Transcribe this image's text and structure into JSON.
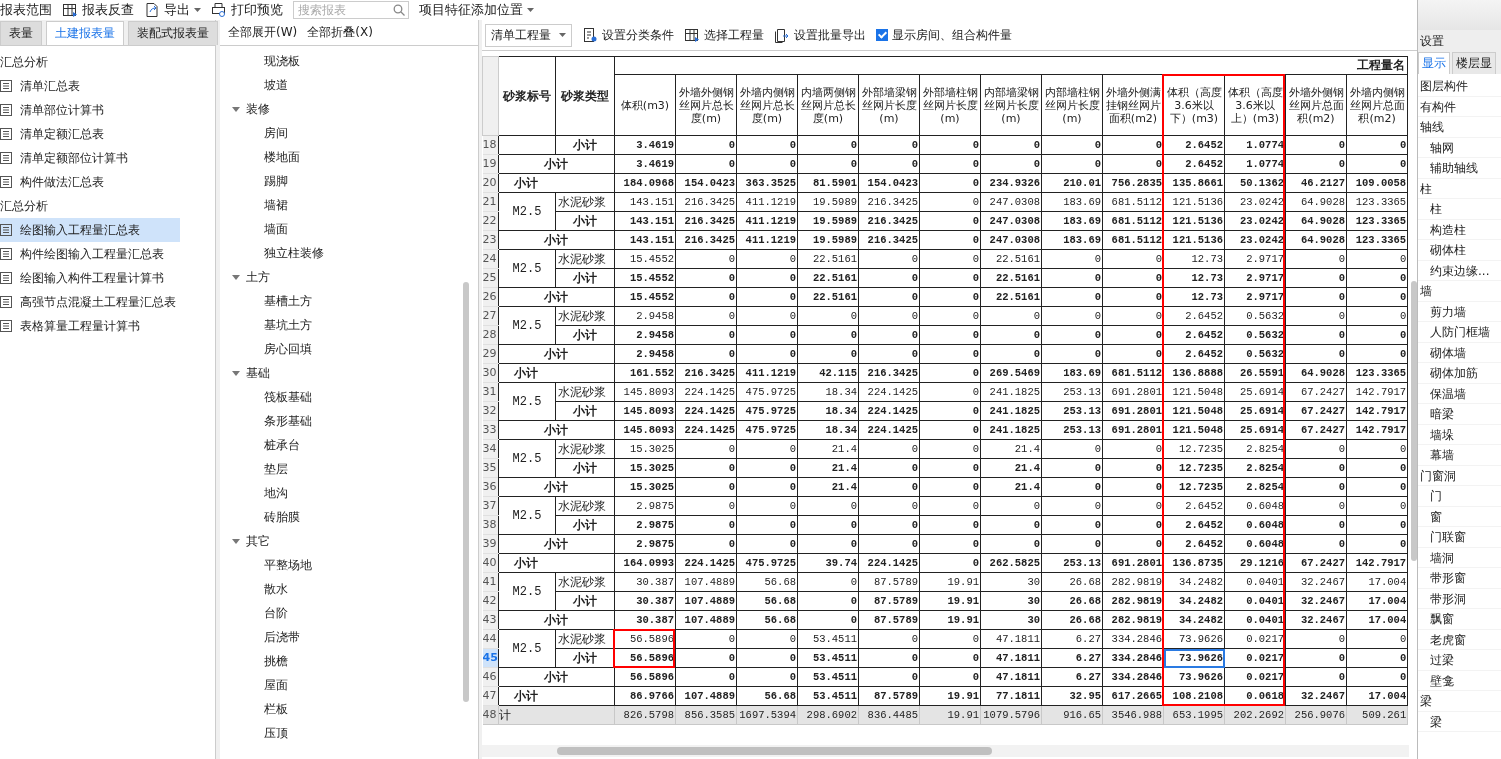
{
  "toolbar": {
    "items": [
      {
        "kind": "button",
        "label": "报表范围"
      },
      {
        "kind": "button",
        "label": "报表反查"
      },
      {
        "kind": "menu",
        "label": "导出"
      },
      {
        "kind": "button",
        "label": "打印预览"
      },
      {
        "kind": "search",
        "placeholder": "搜索报表"
      },
      {
        "kind": "menu",
        "label": "项目特征添加位置"
      }
    ]
  },
  "report_tabs": [
    {
      "label": "表量",
      "selected": false
    },
    {
      "label": "土建报表量",
      "selected": true
    },
    {
      "label": "装配式报表量",
      "selected": false
    }
  ],
  "report_tree": [
    {
      "label": "汇总分析",
      "children": [
        {
          "label": "清单汇总表",
          "selected": false
        },
        {
          "label": "清单部位计算书",
          "selected": false
        },
        {
          "label": "清单定额汇总表",
          "selected": false
        },
        {
          "label": "清单定额部位计算书",
          "selected": false
        },
        {
          "label": "构件做法汇总表",
          "selected": false
        }
      ]
    },
    {
      "label": "汇总分析",
      "children": [
        {
          "label": "绘图输入工程量汇总表",
          "selected": true
        },
        {
          "label": "构件绘图输入工程量汇总表",
          "selected": false
        },
        {
          "label": "绘图输入构件工程量计算书",
          "selected": false
        },
        {
          "label": "高强节点混凝土工程量汇总表",
          "selected": false
        },
        {
          "label": "表格算量工程量计算书",
          "selected": false
        }
      ]
    }
  ],
  "component_panel": {
    "buttons": [
      "全部展开(W)",
      "全部折叠(X)"
    ],
    "continued_items": [
      "现浇板",
      "坡道"
    ],
    "groups": [
      {
        "label": "装修",
        "expanded": true,
        "children": [
          "房间",
          "楼地面",
          "踢脚",
          "墙裙",
          "墙面",
          "独立柱装修"
        ]
      },
      {
        "label": "土方",
        "expanded": true,
        "children": [
          "基槽土方",
          "基坑土方",
          "房心回填"
        ]
      },
      {
        "label": "基础",
        "expanded": true,
        "children": [
          "筏板基础",
          "条形基础",
          "桩承台",
          "垫层",
          "地沟",
          "砖胎膜"
        ]
      },
      {
        "label": "其它",
        "expanded": true,
        "children": [
          "平整场地",
          "散水",
          "台阶",
          "后浇带",
          "挑檐",
          "屋面",
          "栏板",
          "压顶"
        ]
      }
    ]
  },
  "table_toolbar": {
    "dropdown": "清单工程量",
    "buttons": [
      "设置分类条件",
      "选择工程量",
      "设置批量导出"
    ],
    "checkbox": {
      "label": "显示房间、组合构件量",
      "checked": true
    }
  },
  "table": {
    "group_header": "工程量名",
    "columns": [
      "砂浆标号",
      "砂浆类型",
      "体积(m3)",
      "外墙外侧钢丝网片总长度(m)",
      "外墙内侧钢丝网片总长度(m)",
      "内墙两侧钢丝网片总长度(m)",
      "外部墙梁钢丝网片长度(m)",
      "外部墙柱钢丝网片长度(m)",
      "内部墙梁钢丝网片长度(m)",
      "内部墙柱钢丝网片长度(m)",
      "外墙外侧满挂钢丝网片面积(m2)",
      "体积（高度3.6米以下）(m3)",
      "体积（高度3.6米以上）(m3)",
      "外墙外侧钢丝网片总面积(m2)",
      "外墙内侧钢丝网片总面积(m2)"
    ],
    "rows": [
      {
        "num": "18",
        "kind": "sub",
        "label": "小计",
        "selected": false,
        "values": [
          "3.4619",
          "0",
          "0",
          "0",
          "0",
          "0",
          "0",
          "0",
          "0",
          "2.6452",
          "1.0774",
          "0",
          "0"
        ]
      },
      {
        "num": "19",
        "kind": "group",
        "label": "小计",
        "selected": false,
        "values": [
          "3.4619",
          "0",
          "0",
          "0",
          "0",
          "0",
          "0",
          "0",
          "0",
          "2.6452",
          "1.0774",
          "0",
          "0"
        ]
      },
      {
        "num": "20",
        "kind": "total",
        "label": "小计",
        "selected": false,
        "values": [
          "184.0968",
          "154.0423",
          "363.3525",
          "81.5901",
          "154.0423",
          "0",
          "234.9326",
          "210.01",
          "756.2835",
          "135.8661",
          "50.1362",
          "46.2127",
          "109.0058"
        ]
      },
      {
        "num": "21",
        "kind": "detail",
        "grade": "M2.5",
        "label": "水泥砂浆",
        "selected": false,
        "values": [
          "143.151",
          "216.3425",
          "411.1219",
          "19.5989",
          "216.3425",
          "0",
          "247.0308",
          "183.69",
          "681.5112",
          "121.5136",
          "23.0242",
          "64.9028",
          "123.3365"
        ]
      },
      {
        "num": "22",
        "kind": "sub",
        "label": "小计",
        "selected": false,
        "values": [
          "143.151",
          "216.3425",
          "411.1219",
          "19.5989",
          "216.3425",
          "0",
          "247.0308",
          "183.69",
          "681.5112",
          "121.5136",
          "23.0242",
          "64.9028",
          "123.3365"
        ]
      },
      {
        "num": "23",
        "kind": "group",
        "label": "小计",
        "selected": false,
        "values": [
          "143.151",
          "216.3425",
          "411.1219",
          "19.5989",
          "216.3425",
          "0",
          "247.0308",
          "183.69",
          "681.5112",
          "121.5136",
          "23.0242",
          "64.9028",
          "123.3365"
        ]
      },
      {
        "num": "24",
        "kind": "detail",
        "grade": "M2.5",
        "label": "水泥砂浆",
        "selected": false,
        "values": [
          "15.4552",
          "0",
          "0",
          "22.5161",
          "0",
          "0",
          "22.5161",
          "0",
          "0",
          "12.73",
          "2.9717",
          "0",
          "0"
        ]
      },
      {
        "num": "25",
        "kind": "sub",
        "label": "小计",
        "selected": false,
        "values": [
          "15.4552",
          "0",
          "0",
          "22.5161",
          "0",
          "0",
          "22.5161",
          "0",
          "0",
          "12.73",
          "2.9717",
          "0",
          "0"
        ]
      },
      {
        "num": "26",
        "kind": "group",
        "label": "小计",
        "selected": false,
        "values": [
          "15.4552",
          "0",
          "0",
          "22.5161",
          "0",
          "0",
          "22.5161",
          "0",
          "0",
          "12.73",
          "2.9717",
          "0",
          "0"
        ]
      },
      {
        "num": "27",
        "kind": "detail",
        "grade": "M2.5",
        "label": "水泥砂浆",
        "selected": false,
        "values": [
          "2.9458",
          "0",
          "0",
          "0",
          "0",
          "0",
          "0",
          "0",
          "0",
          "2.6452",
          "0.5632",
          "0",
          "0"
        ]
      },
      {
        "num": "28",
        "kind": "sub",
        "label": "小计",
        "selected": false,
        "values": [
          "2.9458",
          "0",
          "0",
          "0",
          "0",
          "0",
          "0",
          "0",
          "0",
          "2.6452",
          "0.5632",
          "0",
          "0"
        ]
      },
      {
        "num": "29",
        "kind": "group",
        "label": "小计",
        "selected": false,
        "values": [
          "2.9458",
          "0",
          "0",
          "0",
          "0",
          "0",
          "0",
          "0",
          "0",
          "2.6452",
          "0.5632",
          "0",
          "0"
        ]
      },
      {
        "num": "30",
        "kind": "total",
        "label": "小计",
        "selected": false,
        "values": [
          "161.552",
          "216.3425",
          "411.1219",
          "42.115",
          "216.3425",
          "0",
          "269.5469",
          "183.69",
          "681.5112",
          "136.8888",
          "26.5591",
          "64.9028",
          "123.3365"
        ]
      },
      {
        "num": "31",
        "kind": "detail",
        "grade": "M2.5",
        "label": "水泥砂浆",
        "selected": false,
        "values": [
          "145.8093",
          "224.1425",
          "475.9725",
          "18.34",
          "224.1425",
          "0",
          "241.1825",
          "253.13",
          "691.2801",
          "121.5048",
          "25.6914",
          "67.2427",
          "142.7917"
        ]
      },
      {
        "num": "32",
        "kind": "sub",
        "label": "小计",
        "selected": false,
        "values": [
          "145.8093",
          "224.1425",
          "475.9725",
          "18.34",
          "224.1425",
          "0",
          "241.1825",
          "253.13",
          "691.2801",
          "121.5048",
          "25.6914",
          "67.2427",
          "142.7917"
        ]
      },
      {
        "num": "33",
        "kind": "group",
        "label": "小计",
        "selected": false,
        "values": [
          "145.8093",
          "224.1425",
          "475.9725",
          "18.34",
          "224.1425",
          "0",
          "241.1825",
          "253.13",
          "691.2801",
          "121.5048",
          "25.6914",
          "67.2427",
          "142.7917"
        ]
      },
      {
        "num": "34",
        "kind": "detail",
        "grade": "M2.5",
        "label": "水泥砂浆",
        "selected": false,
        "values": [
          "15.3025",
          "0",
          "0",
          "21.4",
          "0",
          "0",
          "21.4",
          "0",
          "0",
          "12.7235",
          "2.8254",
          "0",
          "0"
        ]
      },
      {
        "num": "35",
        "kind": "sub",
        "label": "小计",
        "selected": false,
        "values": [
          "15.3025",
          "0",
          "0",
          "21.4",
          "0",
          "0",
          "21.4",
          "0",
          "0",
          "12.7235",
          "2.8254",
          "0",
          "0"
        ]
      },
      {
        "num": "36",
        "kind": "group",
        "label": "小计",
        "selected": false,
        "values": [
          "15.3025",
          "0",
          "0",
          "21.4",
          "0",
          "0",
          "21.4",
          "0",
          "0",
          "12.7235",
          "2.8254",
          "0",
          "0"
        ]
      },
      {
        "num": "37",
        "kind": "detail",
        "grade": "M2.5",
        "label": "水泥砂浆",
        "selected": false,
        "values": [
          "2.9875",
          "0",
          "0",
          "0",
          "0",
          "0",
          "0",
          "0",
          "0",
          "2.6452",
          "0.6048",
          "0",
          "0"
        ]
      },
      {
        "num": "38",
        "kind": "sub",
        "label": "小计",
        "selected": false,
        "values": [
          "2.9875",
          "0",
          "0",
          "0",
          "0",
          "0",
          "0",
          "0",
          "0",
          "2.6452",
          "0.6048",
          "0",
          "0"
        ]
      },
      {
        "num": "39",
        "kind": "group",
        "label": "小计",
        "selected": false,
        "values": [
          "2.9875",
          "0",
          "0",
          "0",
          "0",
          "0",
          "0",
          "0",
          "0",
          "2.6452",
          "0.6048",
          "0",
          "0"
        ]
      },
      {
        "num": "40",
        "kind": "total",
        "label": "小计",
        "selected": false,
        "values": [
          "164.0993",
          "224.1425",
          "475.9725",
          "39.74",
          "224.1425",
          "0",
          "262.5825",
          "253.13",
          "691.2801",
          "136.8735",
          "29.1216",
          "67.2427",
          "142.7917"
        ]
      },
      {
        "num": "41",
        "kind": "detail",
        "grade": "M2.5",
        "label": "水泥砂浆",
        "selected": false,
        "values": [
          "30.387",
          "107.4889",
          "56.68",
          "0",
          "87.5789",
          "19.91",
          "30",
          "26.68",
          "282.9819",
          "34.2482",
          "0.0401",
          "32.2467",
          "17.004"
        ]
      },
      {
        "num": "42",
        "kind": "sub",
        "label": "小计",
        "selected": false,
        "values": [
          "30.387",
          "107.4889",
          "56.68",
          "0",
          "87.5789",
          "19.91",
          "30",
          "26.68",
          "282.9819",
          "34.2482",
          "0.0401",
          "32.2467",
          "17.004"
        ]
      },
      {
        "num": "43",
        "kind": "group",
        "label": "小计",
        "selected": false,
        "values": [
          "30.387",
          "107.4889",
          "56.68",
          "0",
          "87.5789",
          "19.91",
          "30",
          "26.68",
          "282.9819",
          "34.2482",
          "0.0401",
          "32.2467",
          "17.004"
        ]
      },
      {
        "num": "44",
        "kind": "detail",
        "grade": "M2.5",
        "label": "水泥砂浆",
        "selected": false,
        "values": [
          "56.5896",
          "0",
          "0",
          "53.4511",
          "0",
          "0",
          "47.1811",
          "6.27",
          "334.2846",
          "73.9626",
          "0.0217",
          "0",
          "0"
        ]
      },
      {
        "num": "45",
        "kind": "sub",
        "label": "小计",
        "selected": true,
        "values": [
          "56.5896",
          "0",
          "0",
          "53.4511",
          "0",
          "0",
          "47.1811",
          "6.27",
          "334.2846",
          "73.9626",
          "0.0217",
          "0",
          "0"
        ]
      },
      {
        "num": "46",
        "kind": "group",
        "label": "小计",
        "selected": false,
        "values": [
          "56.5896",
          "0",
          "0",
          "53.4511",
          "0",
          "0",
          "47.1811",
          "6.27",
          "334.2846",
          "73.9626",
          "0.0217",
          "0",
          "0"
        ]
      },
      {
        "num": "47",
        "kind": "total",
        "label": "小计",
        "selected": false,
        "values": [
          "86.9766",
          "107.4889",
          "56.68",
          "53.4511",
          "87.5789",
          "19.91",
          "77.1811",
          "32.95",
          "617.2665",
          "108.2108",
          "0.0618",
          "32.2467",
          "17.004"
        ]
      },
      {
        "num": "48",
        "kind": "grand",
        "label": "计",
        "selected": false,
        "values": [
          "826.5798",
          "856.3585",
          "1697.5394",
          "298.6902",
          "836.4485",
          "19.91",
          "1079.5796",
          "916.65",
          "3546.988",
          "653.1995",
          "202.2692",
          "256.9076",
          "509.261"
        ]
      }
    ],
    "annotations": [
      {
        "kind": "box",
        "color": "#ff0000"
      },
      {
        "kind": "box",
        "color": "#ff0000"
      }
    ]
  },
  "layer_panel": {
    "title": "设置",
    "tabs": [
      {
        "label": "显示",
        "selected": true
      },
      {
        "label": "楼层显",
        "selected": false
      }
    ],
    "tree": [
      {
        "label": "图层构件"
      },
      {
        "label": "有构件"
      },
      {
        "label": "轴线",
        "children": [
          {
            "label": "轴网"
          },
          {
            "label": "辅助轴线"
          }
        ]
      },
      {
        "label": "柱",
        "children": [
          {
            "label": "柱"
          },
          {
            "label": "构造柱"
          },
          {
            "label": "砌体柱"
          },
          {
            "label": "约束边缘..."
          }
        ]
      },
      {
        "label": "墙",
        "children": [
          {
            "label": "剪力墙"
          },
          {
            "label": "人防门框墙"
          },
          {
            "label": "砌体墙"
          },
          {
            "label": "砌体加筋"
          },
          {
            "label": "保温墙"
          },
          {
            "label": "暗梁"
          },
          {
            "label": "墙垛"
          },
          {
            "label": "幕墙"
          }
        ]
      },
      {
        "label": "门窗洞",
        "children": [
          {
            "label": "门"
          },
          {
            "label": "窗"
          },
          {
            "label": "门联窗"
          },
          {
            "label": "墙洞"
          },
          {
            "label": "带形窗"
          },
          {
            "label": "带形洞"
          },
          {
            "label": "飘窗"
          },
          {
            "label": "老虎窗"
          },
          {
            "label": "过梁"
          },
          {
            "label": "壁龛"
          }
        ]
      },
      {
        "label": "梁",
        "children": [
          {
            "label": "梁"
          }
        ]
      }
    ]
  }
}
